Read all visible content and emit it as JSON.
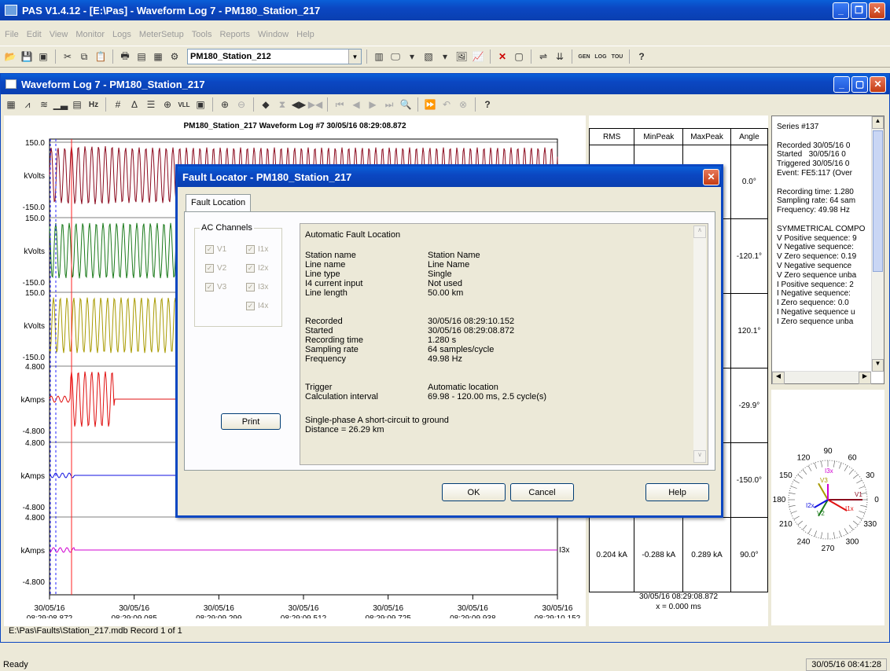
{
  "app": {
    "title": "PAS V1.4.12 - [E:\\Pas] - Waveform Log 7 - PM180_Station_217"
  },
  "menu": [
    "File",
    "Edit",
    "View",
    "Monitor",
    "Logs",
    "MeterSetup",
    "Tools",
    "Reports",
    "Window",
    "Help"
  ],
  "toolbar": {
    "device_select": "PM180_Station_212",
    "gen_label": "GEN",
    "log_label": "LOG",
    "tou_label": "TOU"
  },
  "child": {
    "title": "Waveform Log 7 - PM180_Station_217",
    "hz_label": "Hz",
    "vll_label": "VLL"
  },
  "chart": {
    "title": "PM180_Station_217  Waveform Log #7  30/05/16  08:29:08.872",
    "channels": [
      {
        "top": "150.0",
        "unit": "kVolts",
        "bottom": "-150.0",
        "color": "#8b0a1e"
      },
      {
        "top": "150.0",
        "unit": "kVolts",
        "bottom": "-150.0",
        "color": "#1a7a1a"
      },
      {
        "top": "150.0",
        "unit": "kVolts",
        "bottom": "-150.0",
        "color": "#a89a00"
      },
      {
        "top": "4.800",
        "unit": "kAmps",
        "bottom": "-4.800",
        "color": "#e01010"
      },
      {
        "top": "4.800",
        "unit": "kAmps",
        "bottom": "-4.800",
        "color": "#1010e0"
      },
      {
        "top": "4.800",
        "unit": "kAmps",
        "bottom": "-4.800",
        "color": "#d000d0"
      }
    ],
    "x_dates": [
      "30/05/16",
      "30/05/16",
      "30/05/16",
      "30/05/16",
      "30/05/16",
      "30/05/16",
      "30/05/16"
    ],
    "x_times": [
      "08:29:08.872",
      "08:29:09.085",
      "08:29:09.299",
      "08:29:09.512",
      "08:29:09.725",
      "08:29:09.938",
      "08:29:10.152"
    ],
    "trace_label": "I3x"
  },
  "table": {
    "headers": [
      "RMS",
      "MinPeak",
      "MaxPeak",
      "Angle"
    ],
    "angles": [
      "0.0°",
      "-120.1°",
      "120.1°",
      "-29.9°",
      "-150.0°"
    ],
    "last_row": [
      "0.204 kA",
      "-0.288 kA",
      "0.289 kA",
      "90.0°"
    ],
    "footer_time": "30/05/16 08:29:08.872",
    "footer_x": "x = 0.000 ms"
  },
  "info": {
    "lines": [
      "Series #137",
      "",
      "Recorded 30/05/16 0",
      "Started   30/05/16 0",
      "Triggered 30/05/16 0",
      "Event: FE5:117 (Over",
      "",
      "Recording time: 1.280",
      "Sampling rate: 64 sam",
      "Frequency: 49.98 Hz",
      "",
      "SYMMETRICAL COMPO",
      "V Positive sequence: 9",
      "V Negative sequence:",
      "V Zero sequence: 0.19",
      "V Negative sequence",
      "V Zero sequence unba",
      "I Positive sequence: 2",
      "I Negative sequence:",
      "I Zero sequence: 0.0",
      "I Negative sequence u",
      "I Zero sequence unba"
    ]
  },
  "phasor": {
    "labels": [
      "90",
      "60",
      "120",
      "150",
      "30",
      "180",
      "0",
      "210",
      "330",
      "240",
      "270",
      "300"
    ],
    "v_labels": [
      "V1",
      "V2",
      "V3"
    ],
    "i_labels": [
      "I1x",
      "I2x",
      "I3x"
    ]
  },
  "dialog": {
    "title": "Fault Locator - PM180_Station_217",
    "tab": "Fault Location",
    "group": "AC Channels",
    "checks": [
      "V1",
      "I1x",
      "V2",
      "I2x",
      "V3",
      "I3x",
      "I4x"
    ],
    "print": "Print",
    "header": "Automatic Fault Location",
    "rows1": [
      [
        "Station name",
        "Station Name"
      ],
      [
        "Line name",
        "Line Name"
      ],
      [
        "Line type",
        "Single"
      ],
      [
        "I4 current input",
        "Not used"
      ],
      [
        "Line length",
        "50.00 km"
      ]
    ],
    "rows2": [
      [
        "Recorded",
        "30/05/16  08:29:10.152"
      ],
      [
        "Started",
        "30/05/16  08:29:08.872"
      ],
      [
        "Recording time",
        "1.280 s"
      ],
      [
        "Sampling rate",
        "64 samples/cycle"
      ],
      [
        "Frequency",
        "49.98 Hz"
      ]
    ],
    "rows3": [
      [
        "Trigger",
        "Automatic location"
      ],
      [
        "Calculation interval",
        "69.98 - 120.00 ms, 2.5 cycle(s)"
      ]
    ],
    "result1": "Single-phase A short-circuit to ground",
    "result2": "Distance = 26.29 km",
    "ok": "OK",
    "cancel": "Cancel",
    "help": "Help"
  },
  "statusline": "E:\\Pas\\Faults\\Station_217.mdb  Record 1 of 1",
  "status": {
    "left": "Ready",
    "right": "30/05/16 08:41:28"
  }
}
